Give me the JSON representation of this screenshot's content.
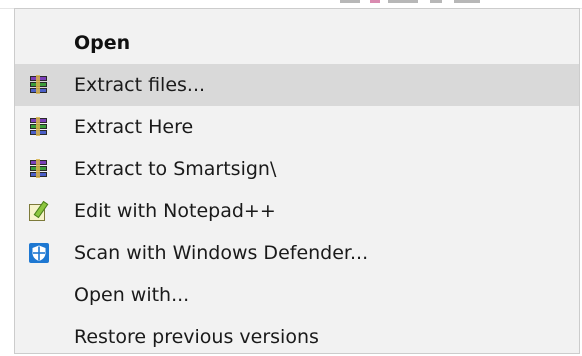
{
  "context_menu": {
    "items": [
      {
        "label": "Open",
        "icon": "",
        "bold": true,
        "highlighted": false
      },
      {
        "label": "Extract files...",
        "icon": "winrar-icon",
        "bold": false,
        "highlighted": true
      },
      {
        "label": "Extract Here",
        "icon": "winrar-icon",
        "bold": false,
        "highlighted": false
      },
      {
        "label": "Extract to Smartsign\\",
        "icon": "winrar-icon",
        "bold": false,
        "highlighted": false
      },
      {
        "label": "Edit with Notepad++",
        "icon": "notepad-plus-plus-icon",
        "bold": false,
        "highlighted": false
      },
      {
        "label": "Scan with Windows Defender...",
        "icon": "windows-defender-shield-icon",
        "bold": false,
        "highlighted": false
      },
      {
        "label": "Open with...",
        "icon": "",
        "bold": false,
        "highlighted": false
      },
      {
        "label": "Restore previous versions",
        "icon": "",
        "bold": false,
        "highlighted": false
      }
    ]
  },
  "colors": {
    "menu_background": "#f2f2f2",
    "highlight": "#d9d9d9",
    "text": "#1a1a1a",
    "defender_blue": "#1e78d2"
  }
}
